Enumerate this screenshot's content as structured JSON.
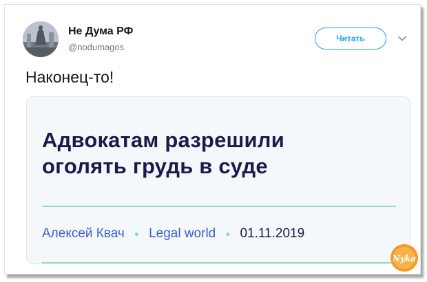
{
  "tweet": {
    "author_name": "Не Дума РФ",
    "author_handle": "@nodumagos",
    "follow_label": "Читать",
    "text": "Наконец-то!"
  },
  "card": {
    "headline_line1": "Адвокатам разрешили",
    "headline_line2": "оголять грудь в суде",
    "author": "Алексей Квач",
    "section": "Legal world",
    "date": "01.11.2019"
  },
  "watermark": {
    "text": "Nyka"
  },
  "colors": {
    "accent": "#1da1f2",
    "headline": "#1c1a4a",
    "link": "#3b5fd0",
    "rule": "#8fe0b6"
  },
  "icons": {
    "avatar": "avatar-image",
    "caret": "chevron-down-icon",
    "watermark": "watermark-logo"
  }
}
